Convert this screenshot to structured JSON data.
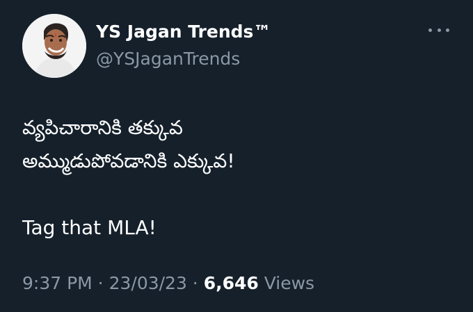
{
  "user": {
    "display_name": "YS Jagan Trends™",
    "handle": "@YSJaganTrends"
  },
  "tweet": {
    "lines": [
      "వ్యపిచారానికి తక్కువ",
      "అమ్ముడుపోవడానికి ఎక్కువ!",
      "Tag that MLA!"
    ]
  },
  "meta": {
    "time": "9:37 PM",
    "separator": " · ",
    "date": "23/03/23",
    "views_count": "6,646",
    "views_label": "Views"
  },
  "icons": {
    "more": "more-horizontal-icon"
  },
  "colors": {
    "background": "#15202b",
    "text_primary": "#ffffff",
    "text_secondary": "#8b98a5"
  }
}
